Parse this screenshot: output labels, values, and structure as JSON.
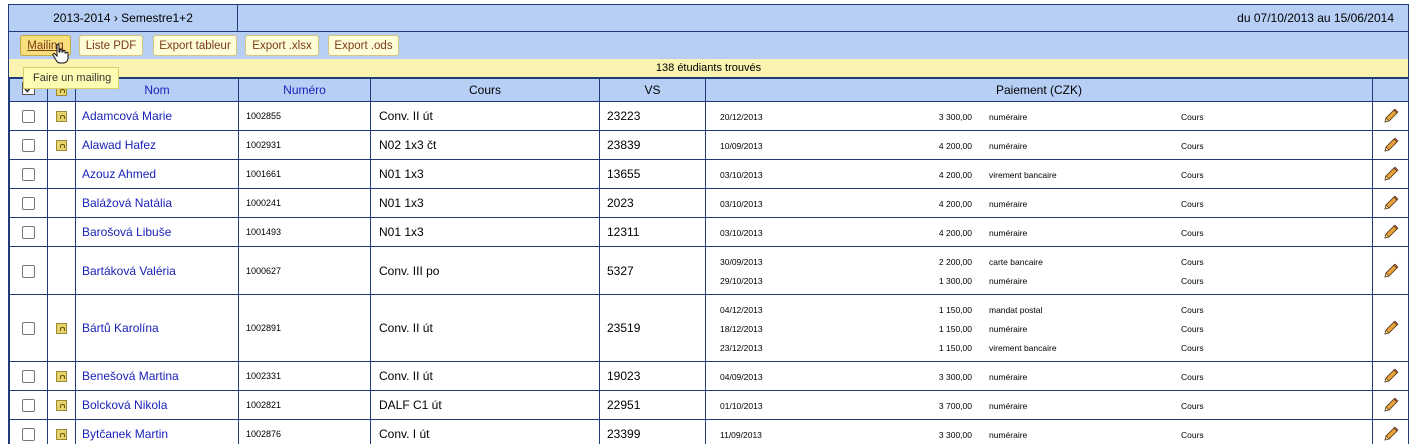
{
  "header": {
    "period": "2013-2014 › Semestre1+2",
    "date_range": "du 07/10/2013 au 15/06/2014"
  },
  "toolbar": {
    "buttons": [
      "Mailing",
      "Liste PDF",
      "Export tableur",
      "Export .xlsx",
      "Export .ods"
    ],
    "tooltip": "Faire un mailing"
  },
  "found_text": "138 étudiants trouvés",
  "columns": {
    "name": "Nom",
    "number": "Numéro",
    "course": "Cours",
    "vs": "VS",
    "payment": "Paiement (CZK)"
  },
  "colors": {
    "header_bg": "#b7cff5",
    "banner_bg": "#fbf4b0",
    "link": "#1a23b8",
    "border": "#1f3b7a"
  },
  "rows": [
    {
      "locked": true,
      "name": "Adamcová Marie",
      "number": "1002855",
      "course": "Conv. II út",
      "vs": "23223",
      "payments": [
        {
          "date": "20/12/2013",
          "amount": "3 300,00",
          "mode": "numéraire",
          "type": "Cours"
        }
      ]
    },
    {
      "locked": true,
      "name": "Alawad Hafez",
      "number": "1002931",
      "course": "N02 1x3 čt",
      "vs": "23839",
      "payments": [
        {
          "date": "10/09/2013",
          "amount": "4 200,00",
          "mode": "numéraire",
          "type": "Cours"
        }
      ]
    },
    {
      "locked": false,
      "name": "Azouz Ahmed",
      "number": "1001661",
      "course": "N01 1x3",
      "vs": "13655",
      "payments": [
        {
          "date": "03/10/2013",
          "amount": "4 200,00",
          "mode": "virement bancaire",
          "type": "Cours"
        }
      ]
    },
    {
      "locked": false,
      "name": "Balážová Natália",
      "number": "1000241",
      "course": "N01 1x3",
      "vs": "2023",
      "payments": [
        {
          "date": "03/10/2013",
          "amount": "4 200,00",
          "mode": "numéraire",
          "type": "Cours"
        }
      ]
    },
    {
      "locked": false,
      "name": "Barošová Libuše",
      "number": "1001493",
      "course": "N01 1x3",
      "vs": "12311",
      "payments": [
        {
          "date": "03/10/2013",
          "amount": "4 200,00",
          "mode": "numéraire",
          "type": "Cours"
        }
      ]
    },
    {
      "locked": false,
      "name": "Bartáková Valéria",
      "number": "1000627",
      "course": "Conv. III po",
      "vs": "5327",
      "payments": [
        {
          "date": "30/09/2013",
          "amount": "2 200,00",
          "mode": "carte bancaire",
          "type": "Cours"
        },
        {
          "date": "29/10/2013",
          "amount": "1 300,00",
          "mode": "numéraire",
          "type": "Cours"
        }
      ]
    },
    {
      "locked": true,
      "name": "Bártů Karolína",
      "number": "1002891",
      "course": "Conv. II út",
      "vs": "23519",
      "payments": [
        {
          "date": "04/12/2013",
          "amount": "1 150,00",
          "mode": "mandat postal",
          "type": "Cours"
        },
        {
          "date": "18/12/2013",
          "amount": "1 150,00",
          "mode": "numéraire",
          "type": "Cours"
        },
        {
          "date": "23/12/2013",
          "amount": "1 150,00",
          "mode": "virement bancaire",
          "type": "Cours"
        }
      ]
    },
    {
      "locked": true,
      "name": "Benešová Martina",
      "number": "1002331",
      "course": "Conv. II út",
      "vs": "19023",
      "payments": [
        {
          "date": "04/09/2013",
          "amount": "3 300,00",
          "mode": "numéraire",
          "type": "Cours"
        }
      ]
    },
    {
      "locked": true,
      "name": "Bolcková Nikola",
      "number": "1002821",
      "course": "DALF C1 út",
      "vs": "22951",
      "payments": [
        {
          "date": "01/10/2013",
          "amount": "3 700,00",
          "mode": "numéraire",
          "type": "Cours"
        }
      ]
    },
    {
      "locked": true,
      "name": "Bytčanek Martin",
      "number": "1002876",
      "course": "Conv. I út",
      "vs": "23399",
      "payments": [
        {
          "date": "11/09/2013",
          "amount": "3 300,00",
          "mode": "numéraire",
          "type": "Cours"
        }
      ]
    }
  ]
}
